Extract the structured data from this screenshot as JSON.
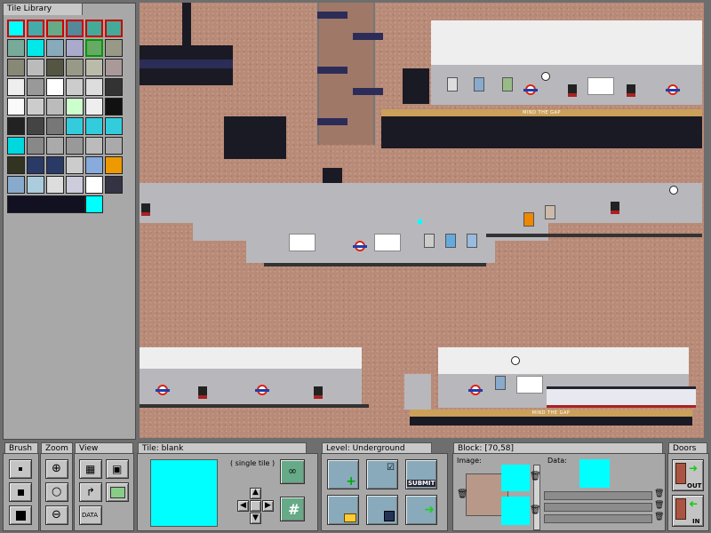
{
  "tile_library": {
    "title": "Tile Library"
  },
  "brush": {
    "label": "Brush"
  },
  "zoom": {
    "label": "Zoom"
  },
  "view": {
    "label": "View",
    "data_button": "DATA"
  },
  "tile": {
    "label": "Tile:",
    "name": "blank",
    "mode": "( single tile )",
    "grid_symbol": "#"
  },
  "level": {
    "label": "Level:",
    "name": "Underground",
    "submit_label": "SUBMIT"
  },
  "block": {
    "label": "Block:",
    "coords": "[70,58]",
    "image_label": "Image:",
    "data_label": "Data:"
  },
  "doors": {
    "label": "Doors",
    "out_label": "OUT",
    "in_label": "IN"
  },
  "map": {
    "mind_the_gap": "MIND THE GAP"
  },
  "colors": {
    "accent_cyan": "#00ffff",
    "roundel_red": "#dd2211",
    "roundel_blue": "#1a3fb0",
    "panel_gray": "#a8a8a8"
  }
}
